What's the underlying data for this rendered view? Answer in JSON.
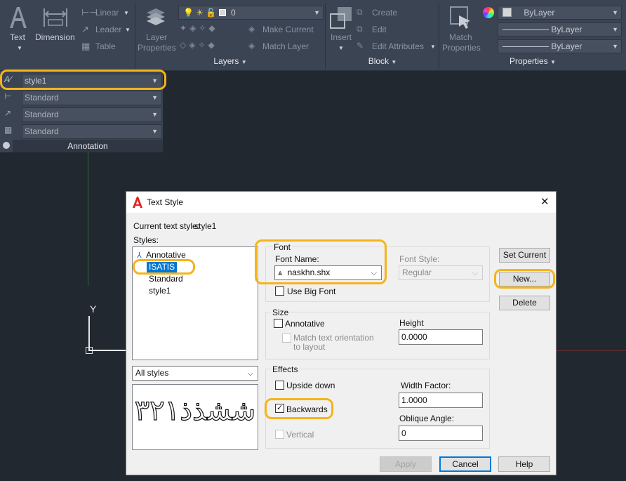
{
  "ribbon": {
    "annotation_panel": {
      "text_label": "Text",
      "dimension_label": "Dimension",
      "linear_label": "Linear",
      "leader_label": "Leader",
      "table_label": "Table",
      "title": "Annotation"
    },
    "layers_panel": {
      "layer_properties_label_1": "Layer",
      "layer_properties_label_2": "Properties",
      "current_layer": "0",
      "make_current_label": "Make Current",
      "match_layer_label": "Match Layer",
      "title": "Layers"
    },
    "block_panel": {
      "insert_label": "Insert",
      "create_label": "Create",
      "edit_label": "Edit",
      "edit_attributes_label": "Edit Attributes",
      "title": "Block"
    },
    "properties_panel": {
      "match_label_1": "Match",
      "match_label_2": "Properties",
      "color_value": "ByLayer",
      "linetype_value": "ByLayer",
      "lineweight_value": "ByLayer",
      "title": "Properties"
    }
  },
  "annotation_ext": {
    "text_style": "style1",
    "dim_style": "Standard",
    "mleader_style": "Standard",
    "table_style": "Standard",
    "panel_title": "Annotation"
  },
  "canvas": {
    "y_axis_label": "Y"
  },
  "dialog": {
    "title": "Text Style",
    "current_style_label": "Current text style:",
    "current_style_value": "style1",
    "styles_label": "Styles:",
    "styles": [
      "Annotative",
      "ISATIS",
      "Standard",
      "style1"
    ],
    "filter_value": "All styles",
    "preview_text": "ششذذ۳۲۱",
    "font_group_title": "Font",
    "font_name_label": "Font Name:",
    "font_name_value": "naskhn.shx",
    "font_style_label": "Font Style:",
    "font_style_value": "Regular",
    "use_big_font_label": "Use Big Font",
    "size_group_title": "Size",
    "annotative_label": "Annotative",
    "match_orientation_label_1": "Match text orientation",
    "match_orientation_label_2": "to layout",
    "height_label": "Height",
    "height_value": "0.0000",
    "effects_group_title": "Effects",
    "upside_down_label": "Upside down",
    "backwards_label": "Backwards",
    "vertical_label": "Vertical",
    "width_factor_label": "Width Factor:",
    "width_factor_value": "1.0000",
    "oblique_angle_label": "Oblique Angle:",
    "oblique_angle_value": "0",
    "set_current_label": "Set Current",
    "new_label": "New...",
    "delete_label": "Delete",
    "apply_label": "Apply",
    "cancel_label": "Cancel",
    "help_label": "Help",
    "close_glyph": "✕"
  },
  "colors": {
    "highlight": "#f5b41b",
    "selection": "#0078d7",
    "app_accent": "#e2211c"
  }
}
